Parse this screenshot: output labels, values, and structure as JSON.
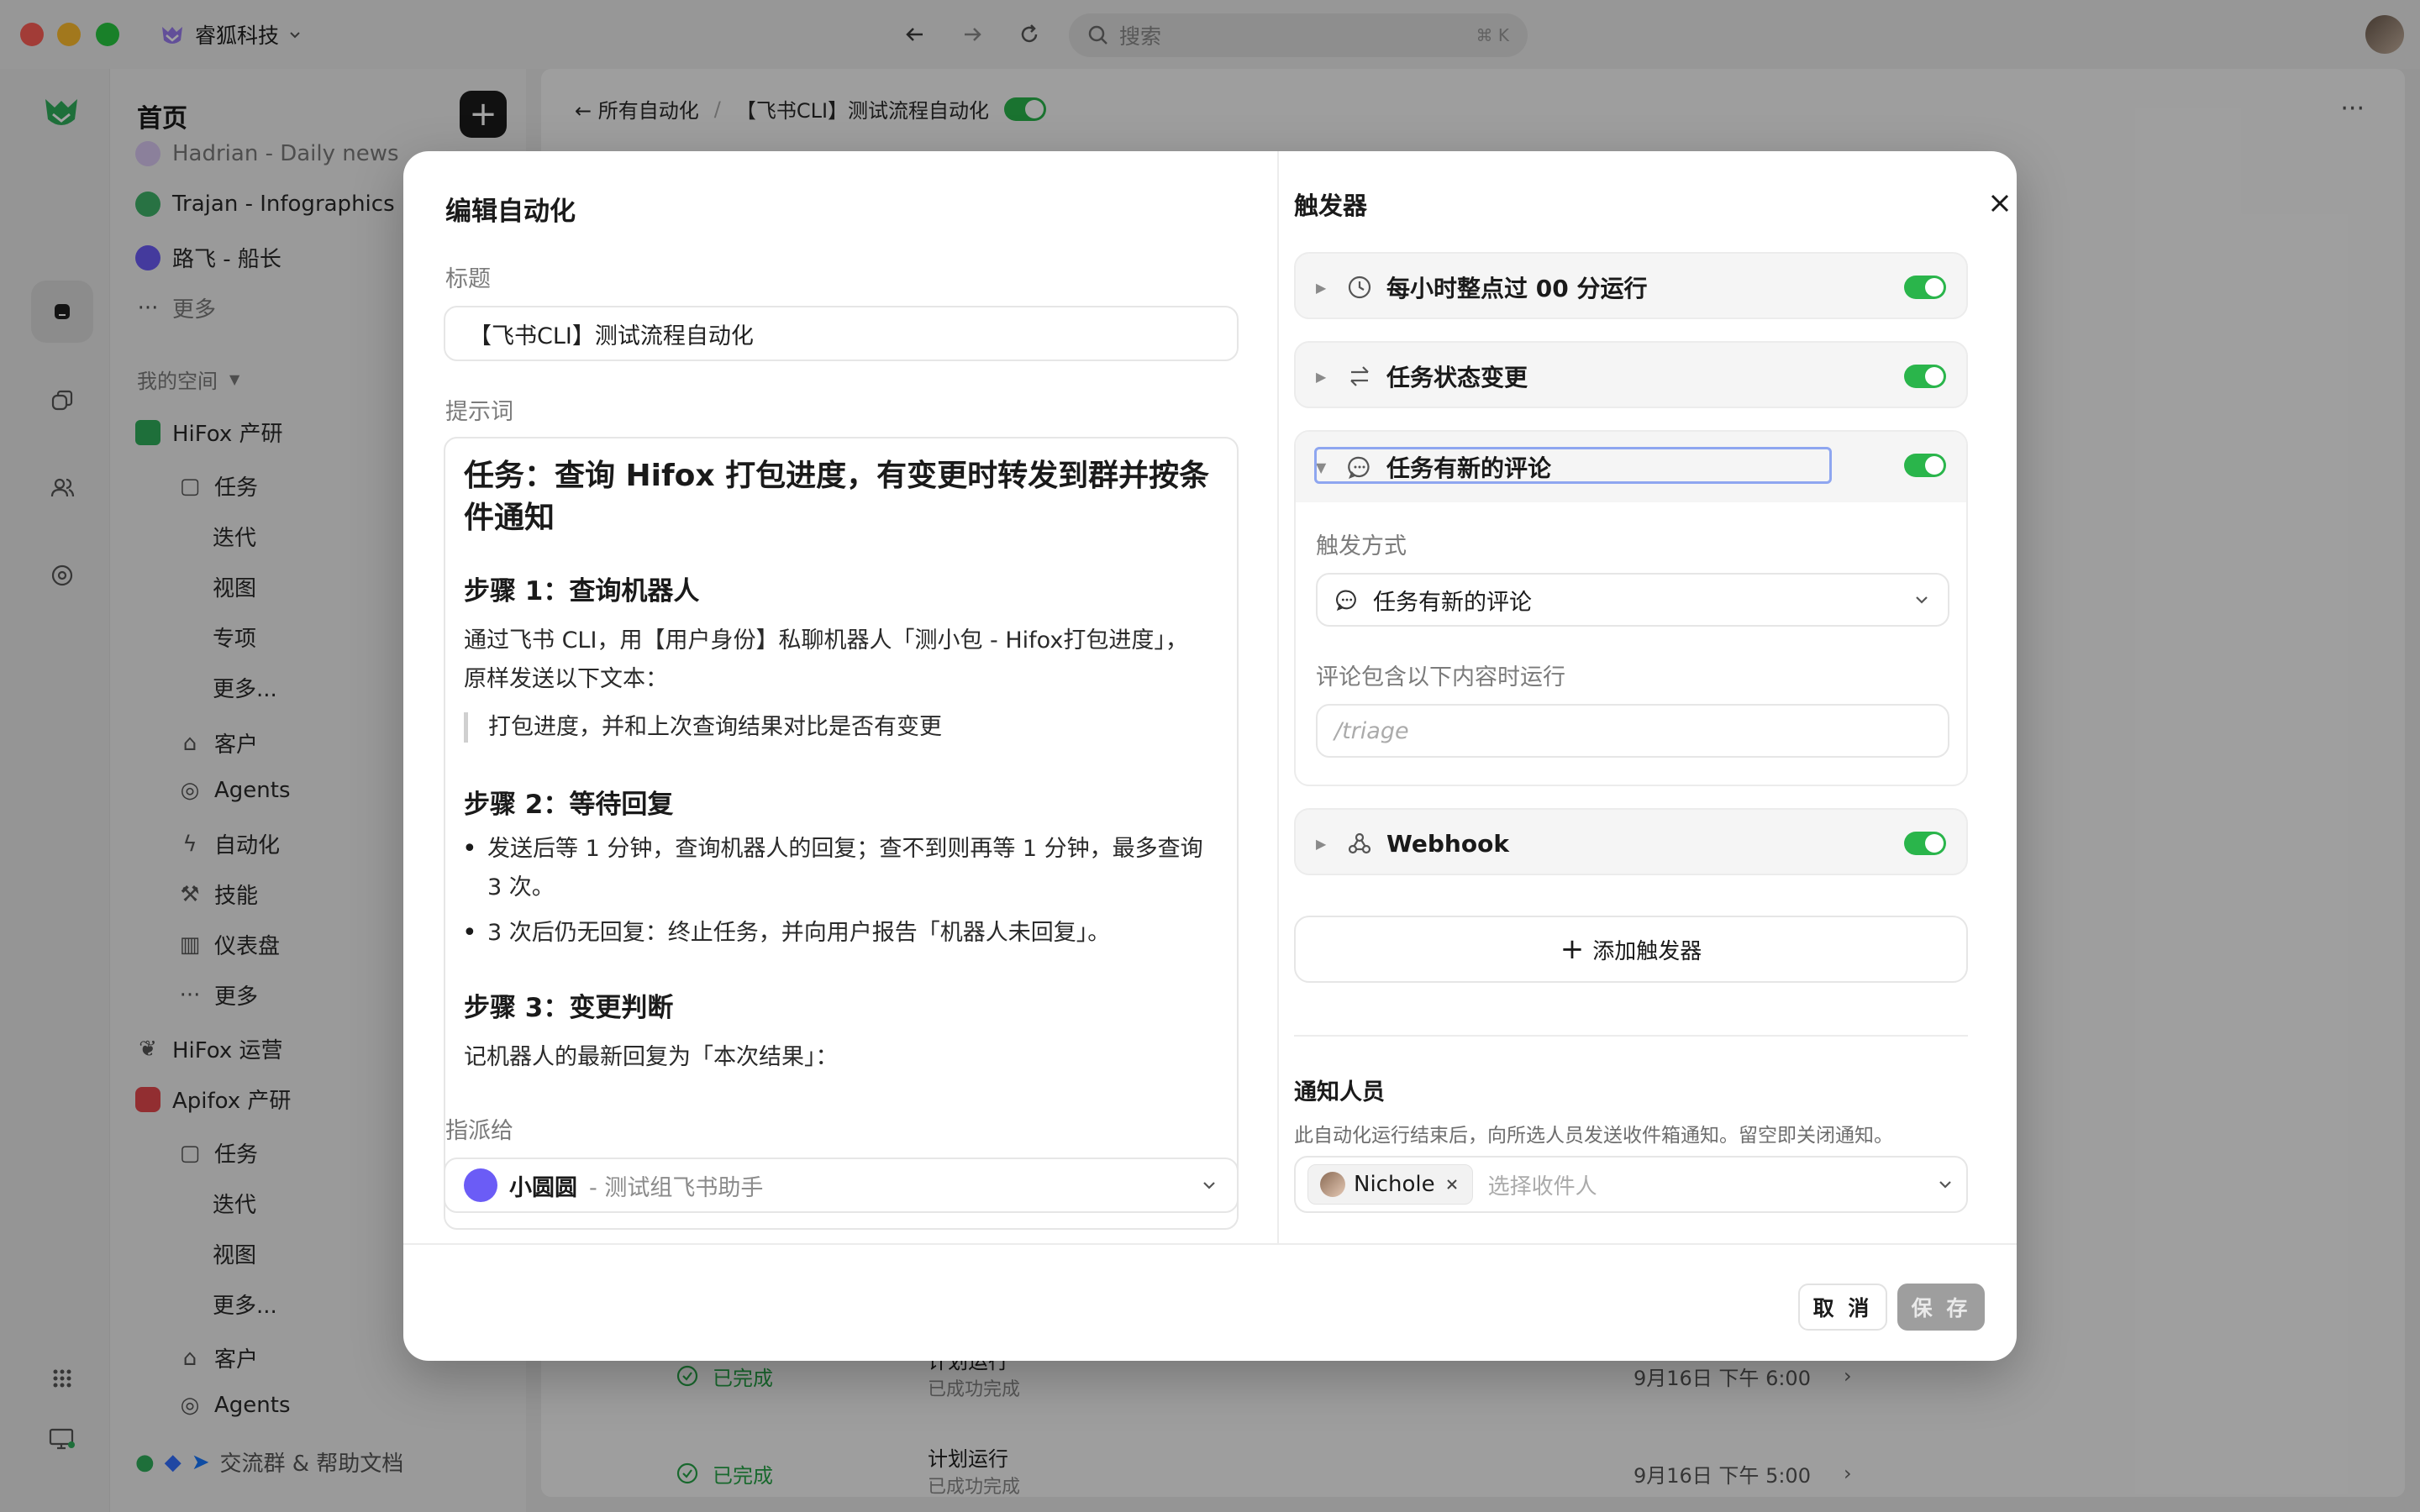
{
  "window": {
    "workspace_name": "睿狐科技",
    "search_placeholder": "搜索",
    "search_shortcut": "⌘ K"
  },
  "sidebar": {
    "title": "首页",
    "pinned": [
      {
        "label": "Hadrian - Daily news",
        "color": "#b48ee8"
      },
      {
        "label": "Trajan - Infographics",
        "color": "#3fb36a"
      },
      {
        "label": "路飞 - 船长",
        "color": "#6b5cf6"
      }
    ],
    "more_label": "更多",
    "my_space_label": "我的空间",
    "spaces": [
      {
        "label": "HiFox 产研",
        "icon": "hifox-logo-icon"
      },
      {
        "label": "任务",
        "icon": "tasks-icon"
      },
      {
        "label": "迭代"
      },
      {
        "label": "视图"
      },
      {
        "label": "专项"
      },
      {
        "label": "更多..."
      },
      {
        "label": "客户",
        "icon": "customer-icon"
      },
      {
        "label": "Agents",
        "icon": "agents-icon"
      },
      {
        "label": "自动化",
        "icon": "bolt-icon"
      },
      {
        "label": "技能",
        "icon": "wrench-icon"
      },
      {
        "label": "仪表盘",
        "icon": "chart-icon"
      },
      {
        "label": "更多",
        "icon": "ellipsis-icon"
      },
      {
        "label": "HiFox 运营",
        "icon": "leaf-icon"
      },
      {
        "label": "Apifox 产研",
        "icon": "apifox-logo-icon"
      },
      {
        "label": "任务",
        "icon": "tasks-icon"
      },
      {
        "label": "迭代"
      },
      {
        "label": "视图"
      },
      {
        "label": "更多..."
      },
      {
        "label": "客户",
        "icon": "customer-icon"
      },
      {
        "label": "Agents",
        "icon": "agents-icon"
      }
    ],
    "footer_label": "交流群 & 帮助文档"
  },
  "main": {
    "breadcrumb_back": "所有自动化",
    "breadcrumb_current": "【飞书CLI】测试流程自动化",
    "runs": [
      {
        "status": "已完成",
        "title": "计划运行",
        "sub": "已成功完成",
        "time": "9月16日 下午 6:00"
      },
      {
        "status": "已完成",
        "title": "计划运行",
        "sub": "已成功完成",
        "time": "9月16日 下午 5:00"
      }
    ]
  },
  "modal": {
    "title": "编辑自动化",
    "title_label": "标题",
    "title_value": "【飞书CLI】测试流程自动化",
    "prompt_label": "提示词",
    "prompt": {
      "h1": "任务：查询 Hifox 打包进度，有变更时转发到群并按条件通知",
      "step1_title": "步骤 1：查询机器人",
      "step1_text": "通过飞书 CLI，用【用户身份】私聊机器人「测小包 - Hifox打包进度」， 原样发送以下文本：",
      "step1_quote": "打包进度，并和上次查询结果对比是否有变更",
      "step2_title": "步骤 2：等待回复",
      "step2_items": [
        "发送后等 1 分钟，查询机器人的回复；查不到则再等 1 分钟，最多查询 3 次。",
        "3 次后仍无回复：终止任务，并向用户报告「机器人未回复」。"
      ],
      "step3_title": "步骤 3：变更判断",
      "step3_text": "记机器人的最新回复为「本次结果」："
    },
    "assign_label": "指派给",
    "assignee_name": "小圆圆",
    "assignee_role": "- 测试组飞书助手",
    "triggers_title": "触发器",
    "triggers": [
      {
        "label": "每小时整点过 00 分运行",
        "icon": "clock-icon",
        "enabled": true
      },
      {
        "label": "任务状态变更",
        "icon": "swap-icon",
        "enabled": true
      },
      {
        "label": "任务有新的评论",
        "icon": "comment-icon",
        "enabled": true
      },
      {
        "label": "Webhook",
        "icon": "webhook-icon",
        "enabled": true
      }
    ],
    "trigger_mode_label": "触发方式",
    "trigger_mode_value": "任务有新的评论",
    "comment_filter_label": "评论包含以下内容时运行",
    "comment_filter_placeholder": "/triage",
    "add_trigger_label": "添加触发器",
    "notify_title": "通知人员",
    "notify_desc": "此自动化运行结束后，向所选人员发送收件箱通知。留空即关闭通知。",
    "recipient_chip": "Nichole",
    "recipient_placeholder": "选择收件人",
    "cancel_label": "取 消",
    "save_label": "保 存"
  },
  "colors": {
    "toggle_on": "#2ab54b",
    "brand_green": "#2fae5b",
    "save_disabled": "#9e9e9e"
  }
}
